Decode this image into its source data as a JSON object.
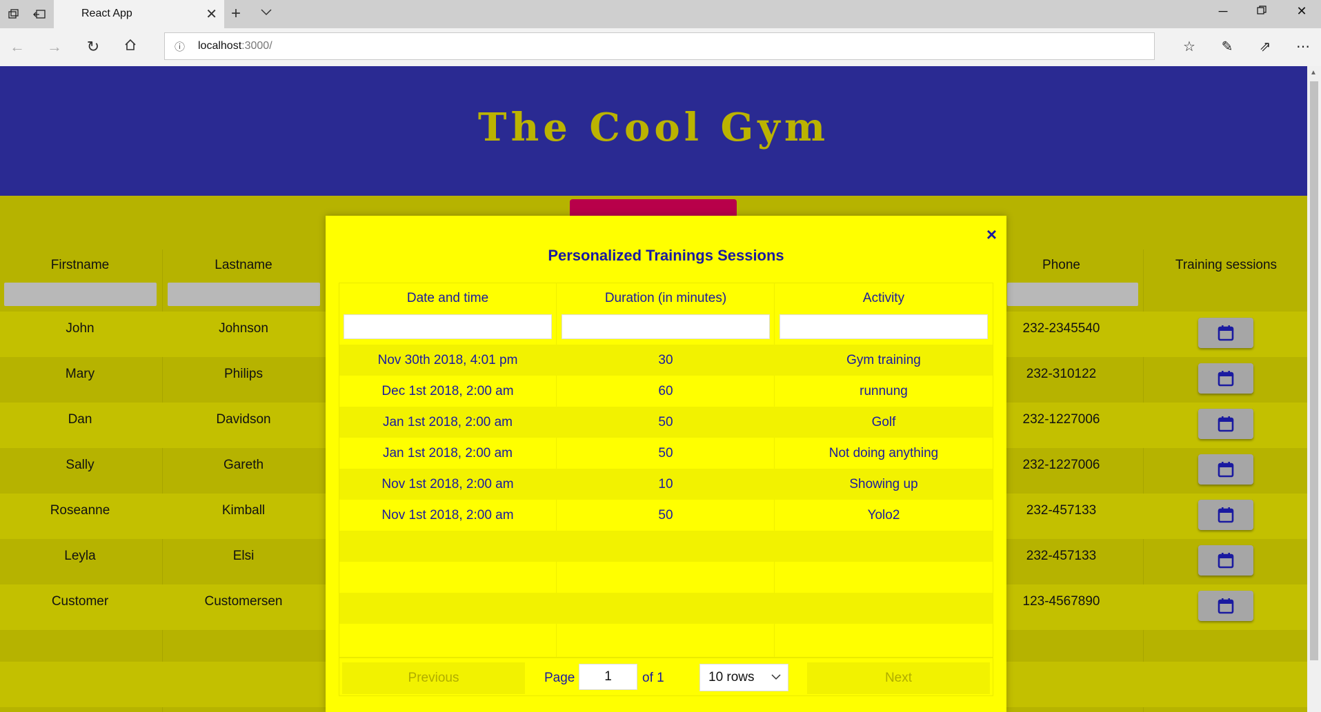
{
  "browser": {
    "tab_title": "React App",
    "url_host": "localhost",
    "url_port": ":3000/"
  },
  "page": {
    "title": "The Cool Gym"
  },
  "customers": {
    "columns": {
      "firstname": "Firstname",
      "lastname": "Lastname",
      "phone": "Phone",
      "sessions": "Training sessions"
    },
    "rows": [
      {
        "firstname": "John",
        "lastname": "Johnson",
        "phone": "232-2345540"
      },
      {
        "firstname": "Mary",
        "lastname": "Philips",
        "phone": "232-310122"
      },
      {
        "firstname": "Dan",
        "lastname": "Davidson",
        "phone": "232-1227006"
      },
      {
        "firstname": "Sally",
        "lastname": "Gareth",
        "phone": "232-1227006"
      },
      {
        "firstname": "Roseanne",
        "lastname": "Kimball",
        "phone": "232-457133"
      },
      {
        "firstname": "Leyla",
        "lastname": "Elsi",
        "phone": "232-457133"
      },
      {
        "firstname": "Customer",
        "lastname": "Customersen",
        "phone": "123-4567890"
      }
    ]
  },
  "modal": {
    "title": "Personalized Trainings Sessions",
    "close_glyph": "×",
    "columns": {
      "date": "Date and time",
      "duration": "Duration (in minutes)",
      "activity": "Activity"
    },
    "rows": [
      {
        "date": "Nov 30th 2018, 4:01 pm",
        "duration": "30",
        "activity": "Gym training"
      },
      {
        "date": "Dec 1st 2018, 2:00 am",
        "duration": "60",
        "activity": "runnung"
      },
      {
        "date": "Jan 1st 2018, 2:00 am",
        "duration": "50",
        "activity": "Golf"
      },
      {
        "date": "Jan 1st 2018, 2:00 am",
        "duration": "50",
        "activity": "Not doing anything"
      },
      {
        "date": "Nov 1st 2018, 2:00 am",
        "duration": "10",
        "activity": "Showing up"
      },
      {
        "date": "Nov 1st 2018, 2:00 am",
        "duration": "50",
        "activity": "Yolo2"
      }
    ],
    "pagination": {
      "previous": "Previous",
      "next": "Next",
      "page_label": "Page",
      "page_value": "1",
      "of_label": "of 1",
      "rows_option": "10 rows"
    }
  },
  "colors": {
    "header_bg": "#2a2a92",
    "title_color": "#bbb300",
    "page_bg": "#b6b300",
    "modal_bg": "#ffff00",
    "modal_text": "#1a1aa0",
    "accent_tab": "#b8004a"
  }
}
